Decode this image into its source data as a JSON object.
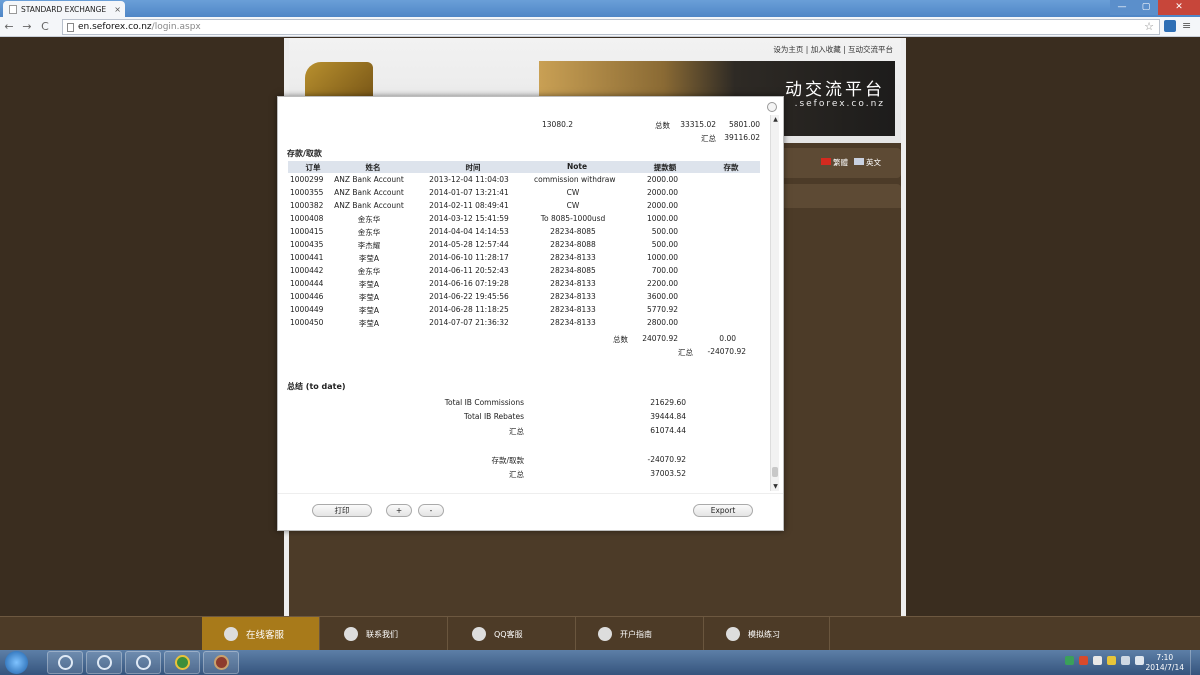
{
  "browser": {
    "tab_title": "STANDARD EXCHANGE",
    "tab_close": "×",
    "url_host": "en.seforex.co.nz",
    "url_path": "/login.aspx",
    "win_min": "—",
    "win_max": "▢",
    "win_close": "✕",
    "back": "←",
    "forward": "→",
    "reload": "C",
    "star": "☆",
    "menu": "≡"
  },
  "site": {
    "top_links": "设为主页 | 加入收藏 | 互动交流平台",
    "banner_slogan": "动交流平台",
    "banner_url": ".seforex.co.nz",
    "lang_cn": "繁體",
    "lang_en": "英文"
  },
  "report": {
    "summary_top": {
      "value1": "13080.2",
      "total_label": "总数",
      "total1": "33315.02",
      "total2": "5801.00",
      "sum_label": "汇总",
      "sum": "39116.02"
    },
    "deposit_section_title": "存款/取款",
    "columns": [
      "订单",
      "姓名",
      "时间",
      "Note",
      "提款额",
      "存款"
    ],
    "rows": [
      {
        "order": "1000299",
        "name": "ANZ Bank Account",
        "time": "2013-12-04 11:04:03",
        "note": "commission withdraw",
        "withdraw": "2000.00",
        "deposit": ""
      },
      {
        "order": "1000355",
        "name": "ANZ Bank Account",
        "time": "2014-01-07 13:21:41",
        "note": "CW",
        "withdraw": "2000.00",
        "deposit": ""
      },
      {
        "order": "1000382",
        "name": "ANZ Bank Account",
        "time": "2014-02-11 08:49:41",
        "note": "CW",
        "withdraw": "2000.00",
        "deposit": ""
      },
      {
        "order": "1000408",
        "name": "金东华",
        "time": "2014-03-12 15:41:59",
        "note": "To 8085-1000usd",
        "withdraw": "1000.00",
        "deposit": ""
      },
      {
        "order": "1000415",
        "name": "金东华",
        "time": "2014-04-04 14:14:53",
        "note": "28234-8085",
        "withdraw": "500.00",
        "deposit": ""
      },
      {
        "order": "1000435",
        "name": "李杰耀",
        "time": "2014-05-28 12:57:44",
        "note": "28234-8088",
        "withdraw": "500.00",
        "deposit": ""
      },
      {
        "order": "1000441",
        "name": "李莹A",
        "time": "2014-06-10 11:28:17",
        "note": "28234-8133",
        "withdraw": "1000.00",
        "deposit": ""
      },
      {
        "order": "1000442",
        "name": "金东华",
        "time": "2014-06-11 20:52:43",
        "note": "28234-8085",
        "withdraw": "700.00",
        "deposit": ""
      },
      {
        "order": "1000444",
        "name": "李莹A",
        "time": "2014-06-16 07:19:28",
        "note": "28234-8133",
        "withdraw": "2200.00",
        "deposit": ""
      },
      {
        "order": "1000446",
        "name": "李莹A",
        "time": "2014-06-22 19:45:56",
        "note": "28234-8133",
        "withdraw": "3600.00",
        "deposit": ""
      },
      {
        "order": "1000449",
        "name": "李莹A",
        "time": "2014-06-28 11:18:25",
        "note": "28234-8133",
        "withdraw": "5770.92",
        "deposit": ""
      },
      {
        "order": "1000450",
        "name": "李莹A",
        "time": "2014-07-07 21:36:32",
        "note": "28234-8133",
        "withdraw": "2800.00",
        "deposit": ""
      }
    ],
    "deposit_totals": {
      "total_label": "总数",
      "withdraw_total": "24070.92",
      "deposit_total": "0.00",
      "sum_label": "汇总",
      "sum": "-24070.92"
    },
    "summary_section_title": "总结 (to date)",
    "summary": {
      "ib_commissions_label": "Total IB Commissions",
      "ib_commissions": "21629.60",
      "ib_rebates_label": "Total IB Rebates",
      "ib_rebates": "39444.84",
      "subtotal_label": "汇总",
      "subtotal": "61074.44",
      "deposit_label": "存款/取款",
      "deposit": "-24070.92",
      "grand_label": "汇总",
      "grand": "37003.52"
    }
  },
  "modal_footer": {
    "print": "打印",
    "zoom_in": "+",
    "zoom_out": "-",
    "export": "Export"
  },
  "bottom_bar": {
    "items": [
      "在线客服",
      "联系我们",
      "QQ客服",
      "开户指南",
      "模拟练习"
    ]
  },
  "taskbar": {
    "time": "7:10",
    "date": "2014/7/14"
  }
}
